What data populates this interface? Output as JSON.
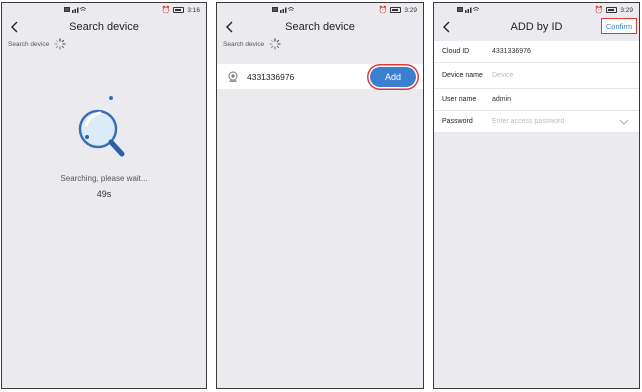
{
  "screens": [
    {
      "status_time": "3:16",
      "title": "Search device",
      "sub_label": "Search device",
      "searching_text": "Searching, please wait...",
      "timer": "49s"
    },
    {
      "status_time": "3:29",
      "title": "Search device",
      "sub_label": "Search device",
      "device_id": "4331336976",
      "add_label": "Add"
    },
    {
      "status_time": "3:29",
      "title": "ADD by ID",
      "confirm_label": "Confirm",
      "fields": [
        {
          "label": "Cloud ID",
          "value": "4331336976",
          "placeholder": ""
        },
        {
          "label": "Device name",
          "value": "",
          "placeholder": "Device"
        },
        {
          "label": "User name",
          "value": "admin",
          "placeholder": ""
        },
        {
          "label": "Password",
          "value": "",
          "placeholder": "Enter access password"
        }
      ]
    }
  ],
  "icons": {
    "back": "back-arrow-icon",
    "spinner": "loading-spinner-icon",
    "magnifier": "magnifier-icon",
    "device": "camera-device-icon",
    "dropdown": "chevron-down-icon"
  },
  "colors": {
    "background": "#ebebef",
    "accent_blue": "#3b7fd0",
    "confirm_text": "#2f86d8",
    "highlight_red": "#e03a3a"
  }
}
